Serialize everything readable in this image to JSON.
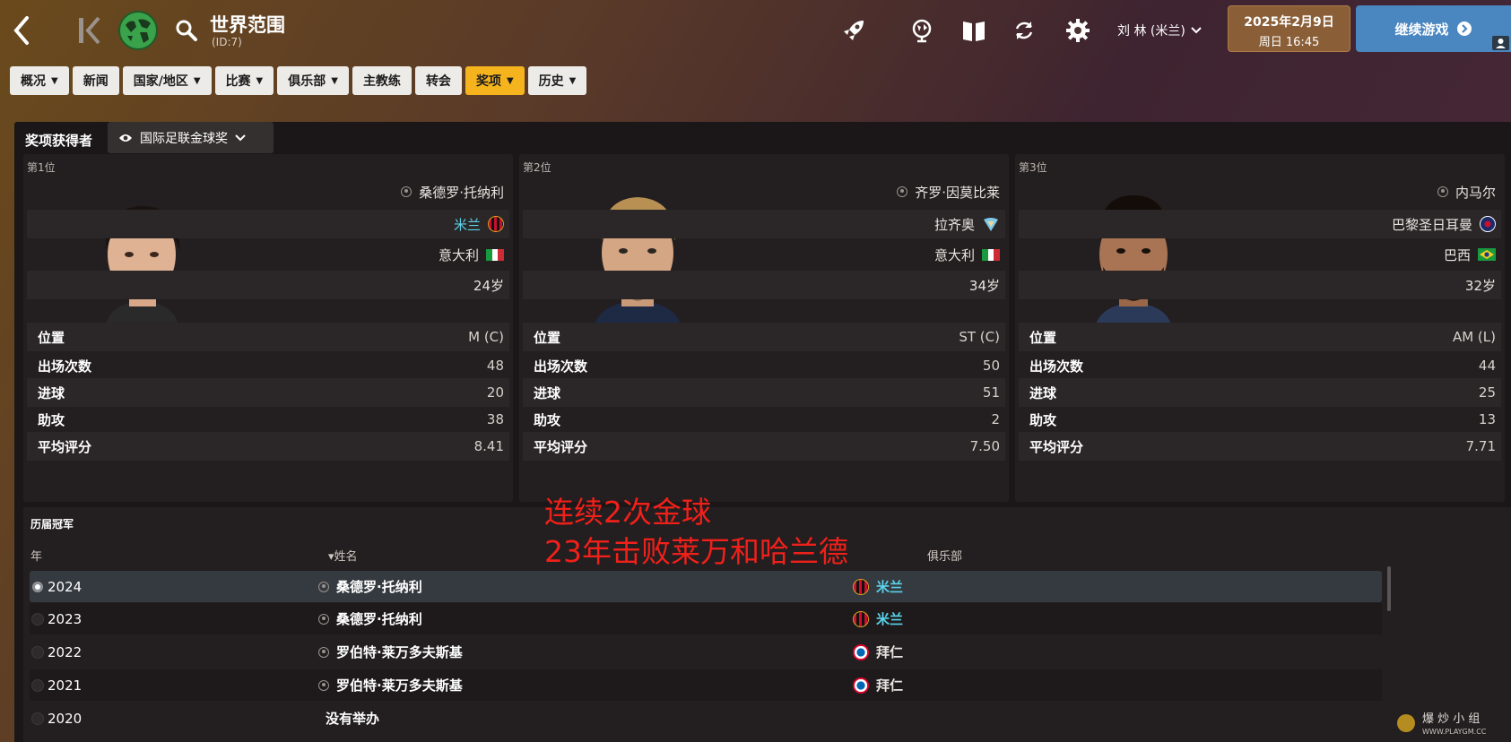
{
  "topbar": {
    "title": "世界范围",
    "subtitle": "(ID:7)",
    "manager": "刘 林 (米兰)",
    "date_line1": "2025年2月9日",
    "date_line2": "周日 16:45",
    "continue_label": "继续游戏"
  },
  "nav": [
    {
      "label": "概况",
      "caret": "⌄"
    },
    {
      "label": "新闻"
    },
    {
      "label": "国家/地区",
      "caret": "⌄"
    },
    {
      "label": "比赛",
      "caret": "⌄"
    },
    {
      "label": "俱乐部",
      "caret": "⌄"
    },
    {
      "label": "主教练"
    },
    {
      "label": "转会"
    },
    {
      "label": "奖项",
      "caret": "⌄",
      "active": true
    },
    {
      "label": "历史",
      "caret": "⌄"
    }
  ],
  "awards": {
    "heading": "奖项获得者",
    "selected_award": "国际足联金球奖",
    "winners": [
      {
        "rank": "第1位",
        "name": "桑德罗·托纳利",
        "club": "米兰",
        "nation": "意大利",
        "age": "24岁",
        "stats": [
          {
            "label": "位置",
            "value": "M (C)"
          },
          {
            "label": "出场次数",
            "value": "48"
          },
          {
            "label": "进球",
            "value": "20"
          },
          {
            "label": "助攻",
            "value": "38"
          },
          {
            "label": "平均评分",
            "value": "8.41"
          }
        ]
      },
      {
        "rank": "第2位",
        "name": "齐罗·因莫比莱",
        "club": "拉齐奥",
        "nation": "意大利",
        "age": "34岁",
        "stats": [
          {
            "label": "位置",
            "value": "ST (C)"
          },
          {
            "label": "出场次数",
            "value": "50"
          },
          {
            "label": "进球",
            "value": "51"
          },
          {
            "label": "助攻",
            "value": "2"
          },
          {
            "label": "平均评分",
            "value": "7.50"
          }
        ]
      },
      {
        "rank": "第3位",
        "name": "内马尔",
        "club": "巴黎圣日耳曼",
        "nation": "巴西",
        "age": "32岁",
        "stats": [
          {
            "label": "位置",
            "value": "AM (L)"
          },
          {
            "label": "出场次数",
            "value": "44"
          },
          {
            "label": "进球",
            "value": "25"
          },
          {
            "label": "助攻",
            "value": "13"
          },
          {
            "label": "平均评分",
            "value": "7.71"
          }
        ]
      }
    ]
  },
  "history": {
    "title": "历届冠军",
    "col_year": "年",
    "col_name": "姓名",
    "col_club": "俱乐部",
    "rows": [
      {
        "year": "2024",
        "name": "桑德罗·托纳利",
        "club": "米兰"
      },
      {
        "year": "2023",
        "name": "桑德罗·托纳利",
        "club": "米兰"
      },
      {
        "year": "2022",
        "name": "罗伯特·莱万多夫斯基",
        "club": "拜仁"
      },
      {
        "year": "2021",
        "name": "罗伯特·莱万多夫斯基",
        "club": "拜仁"
      },
      {
        "year": "2020",
        "name": "没有举办",
        "club": ""
      }
    ]
  },
  "annotation": {
    "line1": "连续2次金球",
    "line2": "23年击败莱万和哈兰德"
  },
  "watermark": {
    "text1": "爆 炒 小 组",
    "text2": "WWW.PLAYGM.CC"
  },
  "colors": {
    "accent_tab": "#f5b31e",
    "club_link": "#5ad2e8",
    "continue": "#4a86c0",
    "annotation": "#f0201a"
  }
}
